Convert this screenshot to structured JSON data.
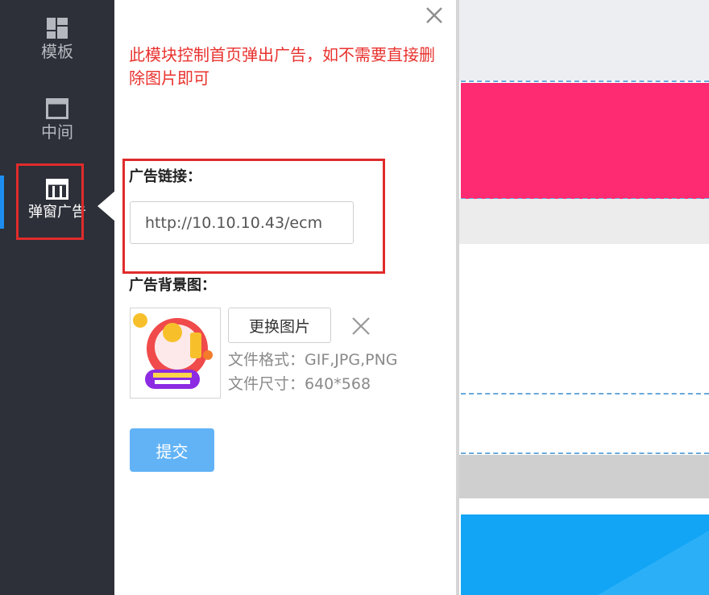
{
  "sidebar": {
    "items": [
      {
        "label": "模板",
        "icon": "template-grid-icon"
      },
      {
        "label": "中间",
        "icon": "middle-layout-icon"
      },
      {
        "label": "弹窗广告",
        "icon": "popup-ad-icon"
      }
    ],
    "active_index": 2
  },
  "panel": {
    "notice": "此模块控制首页弹出广告，如不需要直接删除图片即可",
    "ad_link_label": "广告链接：",
    "ad_link_value": "http://10.10.10.43/ecm",
    "bg_image_label": "广告背景图：",
    "replace_button": "更换图片",
    "file_format": "文件格式：GIF,JPG,PNG",
    "file_size": "文件尺寸：640*568",
    "submit_button": "提交"
  },
  "colors": {
    "sidebar_bg": "#2d3038",
    "notice_red": "#e8322e",
    "highlight_red": "#e02b2b",
    "submit_blue": "#62b3f6",
    "preview_pink": "#fe2a72",
    "preview_blue": "#12a4f5"
  }
}
